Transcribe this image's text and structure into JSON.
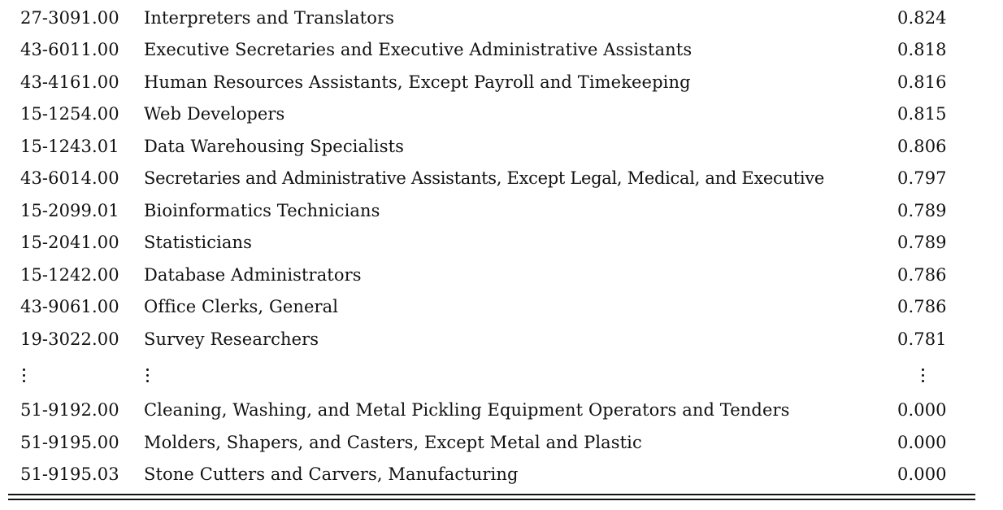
{
  "rows_top": [
    {
      "code": "27-3091.00",
      "occupation": "Interpreters and Translators",
      "score": "0.824"
    },
    {
      "code": "43-6011.00",
      "occupation": "Executive Secretaries and Executive Administrative Assistants",
      "score": "0.818"
    },
    {
      "code": "43-4161.00",
      "occupation": "Human Resources Assistants, Except Payroll and Timekeeping",
      "score": "0.816"
    },
    {
      "code": "15-1254.00",
      "occupation": "Web Developers",
      "score": "0.815"
    },
    {
      "code": "15-1243.01",
      "occupation": "Data Warehousing Specialists",
      "score": "0.806"
    },
    {
      "code": "43-6014.00",
      "occupation": "Secretaries and Administrative Assistants, Except Legal, Medical, and Executive",
      "score": "0.797"
    },
    {
      "code": "15-2099.01",
      "occupation": "Bioinformatics Technicians",
      "score": "0.789"
    },
    {
      "code": "15-2041.00",
      "occupation": "Statisticians",
      "score": "0.789"
    },
    {
      "code": "15-1242.00",
      "occupation": "Database Administrators",
      "score": "0.786"
    },
    {
      "code": "43-9061.00",
      "occupation": "Office Clerks, General",
      "score": "0.786"
    },
    {
      "code": "19-3022.00",
      "occupation": "Survey Researchers",
      "score": "0.781"
    }
  ],
  "rows_bottom": [
    {
      "code": "51-9192.00",
      "occupation": "Cleaning, Washing, and Metal Pickling Equipment Operators and Tenders",
      "score": "0.000"
    },
    {
      "code": "51-9195.00",
      "occupation": "Molders, Shapers, and Casters, Except Metal and Plastic",
      "score": "0.000"
    },
    {
      "code": "51-9195.03",
      "occupation": "Stone Cutters and Carvers, Manufacturing",
      "score": "0.000"
    }
  ]
}
